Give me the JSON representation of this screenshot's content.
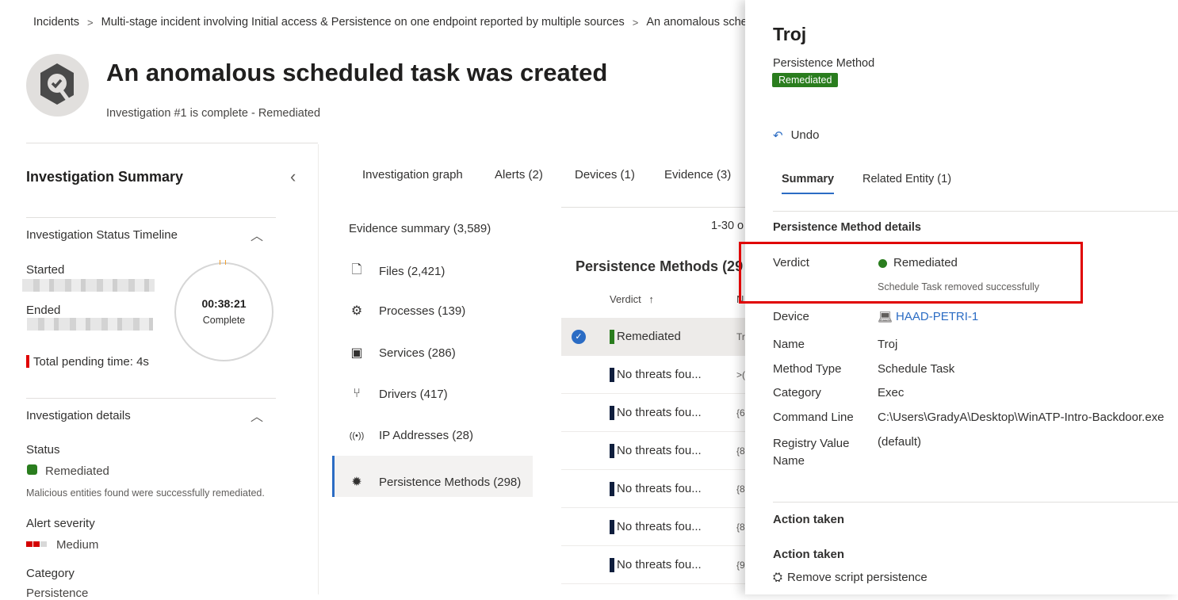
{
  "breadcrumb": [
    "Incidents",
    "Multi-stage incident involving Initial access & Persistence on one endpoint reported by multiple sources",
    "An anomalous scheduled task was created"
  ],
  "header": {
    "title": "An anomalous scheduled task was created",
    "subtitle": "Investigation #1 is complete - Remediated",
    "icon": "investigation-complete-icon"
  },
  "summary": {
    "title": "Investigation Summary",
    "timeline": {
      "title": "Investigation Status Timeline",
      "started_label": "Started",
      "ended_label": "Ended",
      "duration": "00:38:21",
      "state": "Complete",
      "pending": "Total pending time: 4s"
    },
    "details": {
      "title": "Investigation details",
      "status_label": "Status",
      "status": "Remediated",
      "status_desc": "Malicious entities found were successfully remediated.",
      "severity_label": "Alert severity",
      "severity": "Medium",
      "category_label": "Category",
      "category": "Persistence"
    }
  },
  "tabs": [
    "Investigation graph",
    "Alerts  (2)",
    "Devices  (1)",
    "Evidence  (3)"
  ],
  "evidence": {
    "summary": "Evidence summary (3,589)",
    "items": [
      {
        "label": "Files (2,421)",
        "icon": "file-icon"
      },
      {
        "label": "Processes (139)",
        "icon": "gear-icon"
      },
      {
        "label": "Services (286)",
        "icon": "service-icon"
      },
      {
        "label": "Drivers (417)",
        "icon": "driver-icon"
      },
      {
        "label": "IP Addresses (28)",
        "icon": "broadcast-icon"
      },
      {
        "label": "Persistence Methods (298)",
        "icon": "bug-icon"
      }
    ]
  },
  "table": {
    "paging": "1-30 o",
    "title": "Persistence Methods (29",
    "col_verdict": "Verdict",
    "col2": "N",
    "rows": [
      {
        "verdict": "Remediated",
        "name": "Tr",
        "color": "#2a7d1e"
      },
      {
        "verdict": "No threats fou...",
        "name": ">(",
        "color": "#0f1e3d"
      },
      {
        "verdict": "No threats fou...",
        "name": "{6",
        "color": "#0f1e3d"
      },
      {
        "verdict": "No threats fou...",
        "name": "{8",
        "color": "#0f1e3d"
      },
      {
        "verdict": "No threats fou...",
        "name": "{8",
        "color": "#0f1e3d"
      },
      {
        "verdict": "No threats fou...",
        "name": "{8",
        "color": "#0f1e3d"
      },
      {
        "verdict": "No threats fou...",
        "name": "{9",
        "color": "#0f1e3d"
      }
    ]
  },
  "panel": {
    "title": "Troj",
    "type": "Persistence Method",
    "badge": "Remediated",
    "undo": "Undo",
    "tabs": [
      "Summary",
      "Related Entity  (1)"
    ],
    "details_title": "Persistence Method details",
    "verdict_label": "Verdict",
    "verdict": "Remediated",
    "verdict_note": "Schedule Task removed successfully",
    "device_label": "Device",
    "device": "HAAD-PETRI-1",
    "name_label": "Name",
    "name": "Troj",
    "method_label": "Method Type",
    "method": "Schedule Task",
    "category_label": "Category",
    "category": "Exec",
    "cmd_label": "Command Line",
    "cmd": "C:\\Users\\GradyA\\Desktop\\WinATP-Intro-Backdoor.exe",
    "reg_label": "Registry Value Name",
    "reg": "(default)",
    "action_section": "Action taken",
    "action_label": "Action taken",
    "action": "Remove script persistence"
  },
  "colors": {
    "accent": "#2b6cc4",
    "remediated": "#2a7d1e",
    "highlight": "#e00000",
    "severity": "#d40000"
  }
}
